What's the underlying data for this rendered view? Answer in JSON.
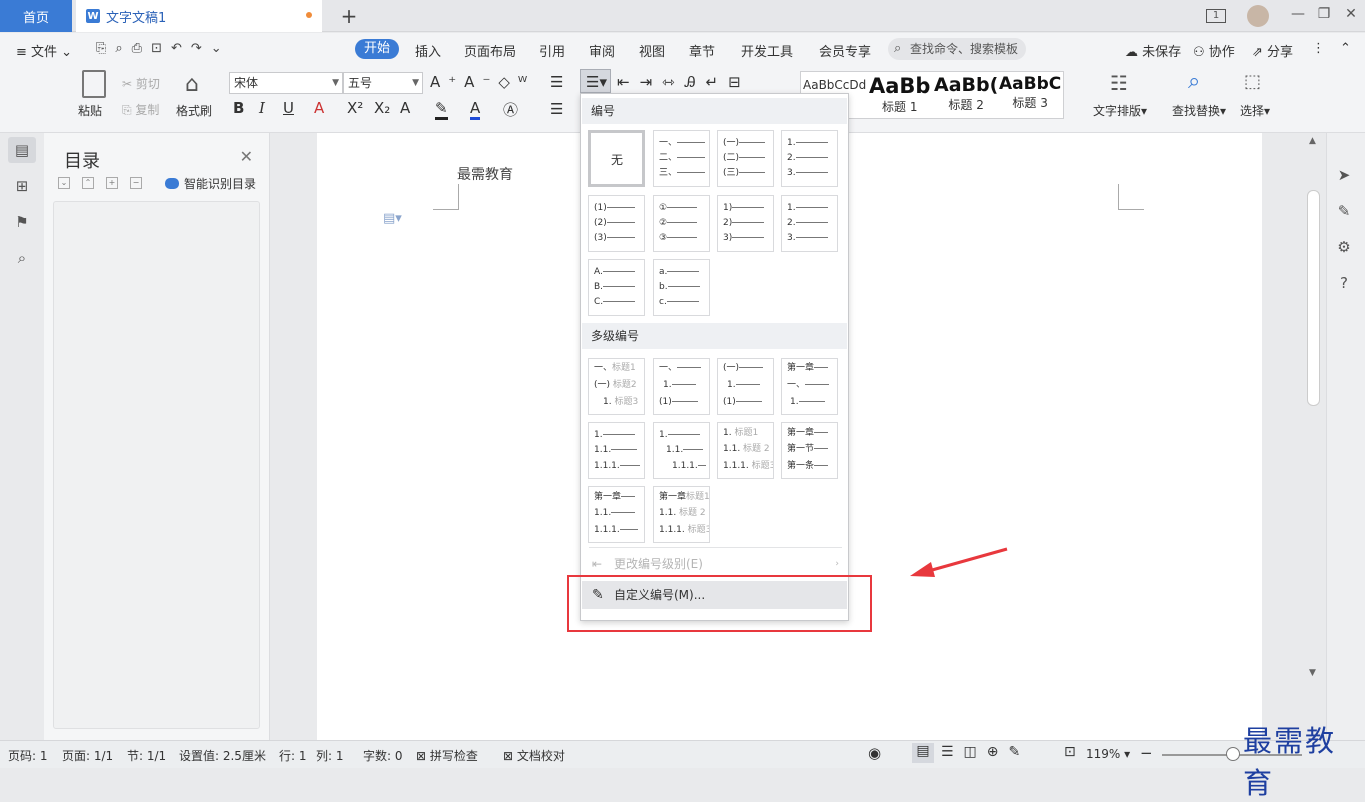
{
  "tabs": {
    "home": "首页",
    "doc": "文字文稿1",
    "add": "+"
  },
  "window": {
    "page_count": "1",
    "minimize": "—",
    "restore": "❐",
    "close": "✕"
  },
  "menubar": {
    "file": "文件",
    "items": [
      "开始",
      "插入",
      "页面布局",
      "引用",
      "审阅",
      "视图",
      "章节",
      "开发工具",
      "会员专享"
    ],
    "search": "查找命令、搜索模板",
    "unsaved": "未保存",
    "collab": "协作",
    "share": "分享"
  },
  "ribbon": {
    "paste": "粘贴",
    "cut": "剪切",
    "copy": "复制",
    "format_painter": "格式刷",
    "font": "宋体",
    "size": "五号",
    "styles": [
      {
        "sample": "AaBbCcDd",
        "name": ""
      },
      {
        "sample": "AaBb",
        "name": "标题 1"
      },
      {
        "sample": "AaBb(",
        "name": "标题 2"
      },
      {
        "sample": "AaBbC",
        "name": "标题 3"
      }
    ],
    "text_layout": "文字排版",
    "find_replace": "查找替换",
    "select": "选择"
  },
  "nav": {
    "title": "目录",
    "smart": "智能识别目录"
  },
  "document": {
    "text": "最需教育"
  },
  "dropdown": {
    "section1": "编号",
    "section2": "多级编号",
    "none": "无",
    "change_level": "更改编号级别(E)",
    "custom": "自定义编号(M)..."
  },
  "status": {
    "page_no": "页码: 1",
    "pages": "页面: 1/1",
    "section": "节: 1/1",
    "setting": "设置值: 2.5厘米",
    "row": "行: 1",
    "col": "列: 1",
    "words": "字数: 0",
    "spell": "拼写检查",
    "proof": "文档校对",
    "zoom": "119%"
  },
  "watermark": "最需教育",
  "colors": {
    "accent": "#3a7bd5",
    "highlight": "#e8383d"
  }
}
